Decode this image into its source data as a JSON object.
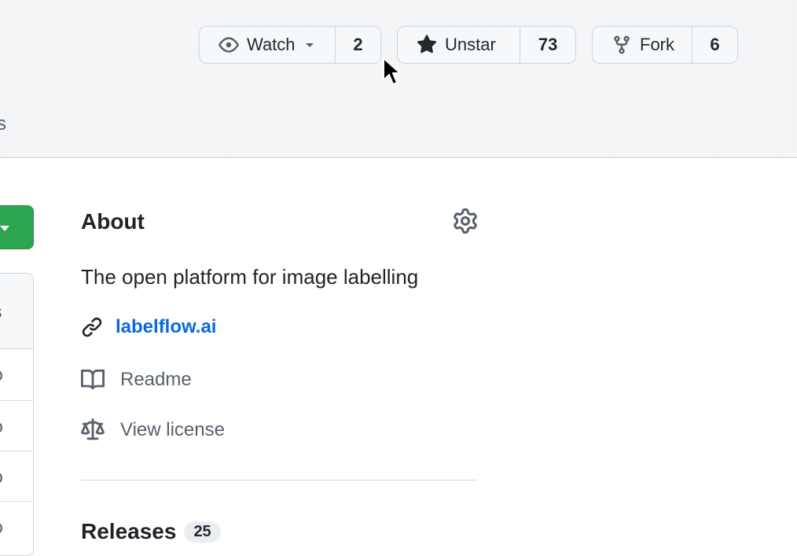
{
  "actions": {
    "watch": {
      "label": "Watch",
      "count": "2"
    },
    "star": {
      "label": "Unstar",
      "count": "73"
    },
    "fork": {
      "label": "Fork",
      "count": "6"
    }
  },
  "nav": {
    "partial_tab": "s"
  },
  "file_list": {
    "header_fragment": "s",
    "row_fragments": [
      "o",
      "o",
      "o",
      "o"
    ]
  },
  "about": {
    "title": "About",
    "description": "The open platform for image labelling",
    "website": "labelflow.ai",
    "readme_label": "Readme",
    "license_label": "View license"
  },
  "releases": {
    "title": "Releases",
    "count": "25"
  },
  "colors": {
    "link": "#0969da",
    "primary_button": "#2da44e",
    "border": "#d0d7de",
    "muted_text": "#57606a"
  },
  "icons": [
    "eye-icon",
    "triangle-down-icon",
    "star-fill-icon",
    "repo-forked-icon",
    "gear-icon",
    "link-icon",
    "book-icon",
    "law-icon",
    "mouse-cursor-icon"
  ]
}
